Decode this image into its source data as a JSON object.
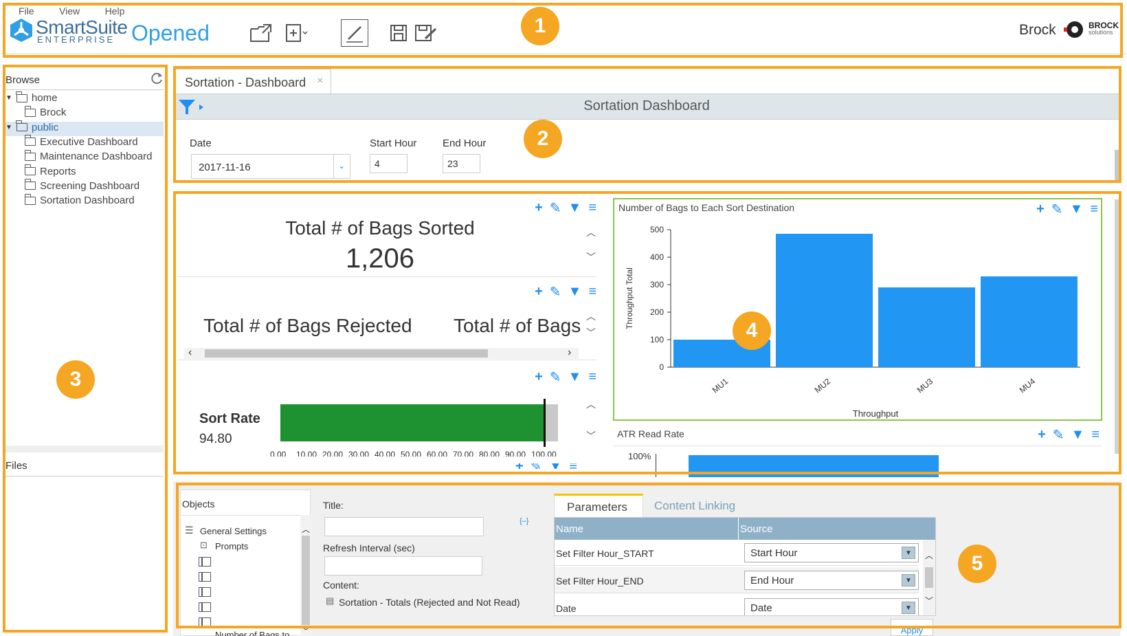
{
  "menu": {
    "file": "File",
    "view": "View",
    "help": "Help"
  },
  "brand": {
    "name": "SmartSuite",
    "sub": "ENTERPRISE",
    "state": "Opened",
    "user": "Brock",
    "company": "BROCK",
    "company_sub": "solutions"
  },
  "callouts": [
    "1",
    "2",
    "3",
    "4",
    "5"
  ],
  "sidebar": {
    "browse_label": "Browse",
    "files_label": "Files",
    "tree": [
      {
        "label": "home",
        "level": 0,
        "expanded": true
      },
      {
        "label": "Brock",
        "level": 1
      },
      {
        "label": "public",
        "level": 0,
        "expanded": true,
        "selected": true
      },
      {
        "label": "Executive Dashboard",
        "level": 1
      },
      {
        "label": "Maintenance Dashboard",
        "level": 1
      },
      {
        "label": "Reports",
        "level": 1
      },
      {
        "label": "Screening Dashboard",
        "level": 1
      },
      {
        "label": "Sortation Dashboard",
        "level": 1
      }
    ]
  },
  "tab": {
    "label": "Sortation - Dashboard",
    "close": "×"
  },
  "dashboard": {
    "title": "Sortation Dashboard"
  },
  "filters": {
    "date_label": "Date",
    "date_value": "2017-11-16",
    "start_label": "Start Hour",
    "start_value": "4",
    "end_label": "End Hour",
    "end_value": "23"
  },
  "widgets": {
    "bags_sorted": {
      "title": "Total # of Bags Sorted",
      "value": "1,206"
    },
    "bags_rejected": {
      "title": "Total # of Bags Rejected",
      "title2": "Total # of Bags"
    },
    "sort_rate": {
      "label": "Sort Rate",
      "value": "94.80",
      "fraction": 0.948,
      "ticks": [
        "0.00",
        "10.00",
        "20.00",
        "30.00",
        "40.00",
        "50.00",
        "60.00",
        "70.00",
        "80.00",
        "90.00",
        "100.00"
      ]
    },
    "atr": {
      "title": "ATR Read Rate",
      "tick_100": "100%"
    }
  },
  "chart_data": {
    "type": "bar",
    "title": "Number of Bags to Each Sort Destination",
    "xlabel": "Throughput",
    "ylabel": "Throughput Total",
    "categories": [
      "MU1",
      "MU2",
      "MU3",
      "MU4"
    ],
    "values": [
      100,
      485,
      290,
      330
    ],
    "ylim": [
      0,
      500
    ],
    "yticks": [
      0,
      100,
      200,
      300,
      400,
      500
    ],
    "color": "#2196f3",
    "grid": false
  },
  "editor": {
    "objects_label": "Objects",
    "general_settings": "General Settings",
    "prompts": "Prompts",
    "last_object": "Number of Bags to",
    "title_label": "Title:",
    "refresh_label": "Refresh Interval (sec)",
    "content_label": "Content:",
    "content_value": "Sortation - Totals (Rejected and Not Read)",
    "tab_params": "Parameters",
    "tab_linking": "Content Linking",
    "col_name": "Name",
    "col_source": "Source",
    "rows": [
      {
        "name": "Set Filter Hour_START",
        "source": "Start Hour"
      },
      {
        "name": "Set Filter Hour_END",
        "source": "End Hour"
      },
      {
        "name": "Date",
        "source": "Date"
      }
    ],
    "apply": "Apply"
  },
  "colors": {
    "accent": "#f5a623",
    "brand": "#2f9fe6",
    "bar": "#2196f3",
    "sort_bar": "#1e9130",
    "header_grid": "#8eb1c8"
  }
}
